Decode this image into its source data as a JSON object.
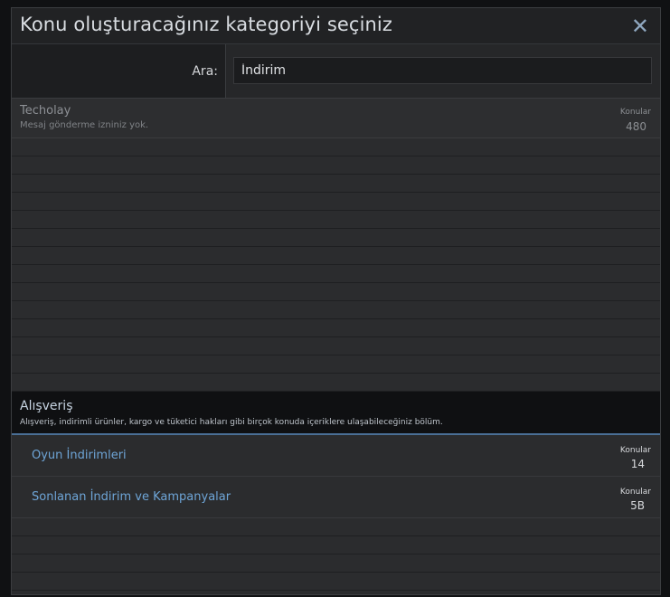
{
  "modal": {
    "title": "Konu oluşturacağınız kategoriyi seçiniz",
    "close_icon": "close-icon"
  },
  "search": {
    "label": "Ara:",
    "value": "İndirim"
  },
  "category": {
    "title": "Techolay",
    "description": "Mesaj gönderme izniniz yok.",
    "stat_label": "Konular",
    "stat_value": "480"
  },
  "section": {
    "title": "Alışveriş",
    "description": "Alışveriş, indirimli ürünler, kargo ve tüketici hakları gibi birçok konuda içeriklere ulaşabileceğiniz bölüm."
  },
  "forums": [
    {
      "title": "Oyun İndirimleri",
      "stat_label": "Konular",
      "stat_value": "14"
    },
    {
      "title": "Sonlanan İndirim ve Kampanyalar",
      "stat_label": "Konular",
      "stat_value": "5B"
    }
  ],
  "colors": {
    "accent": "#6ea5d7",
    "section_border": "#4a6f96"
  }
}
